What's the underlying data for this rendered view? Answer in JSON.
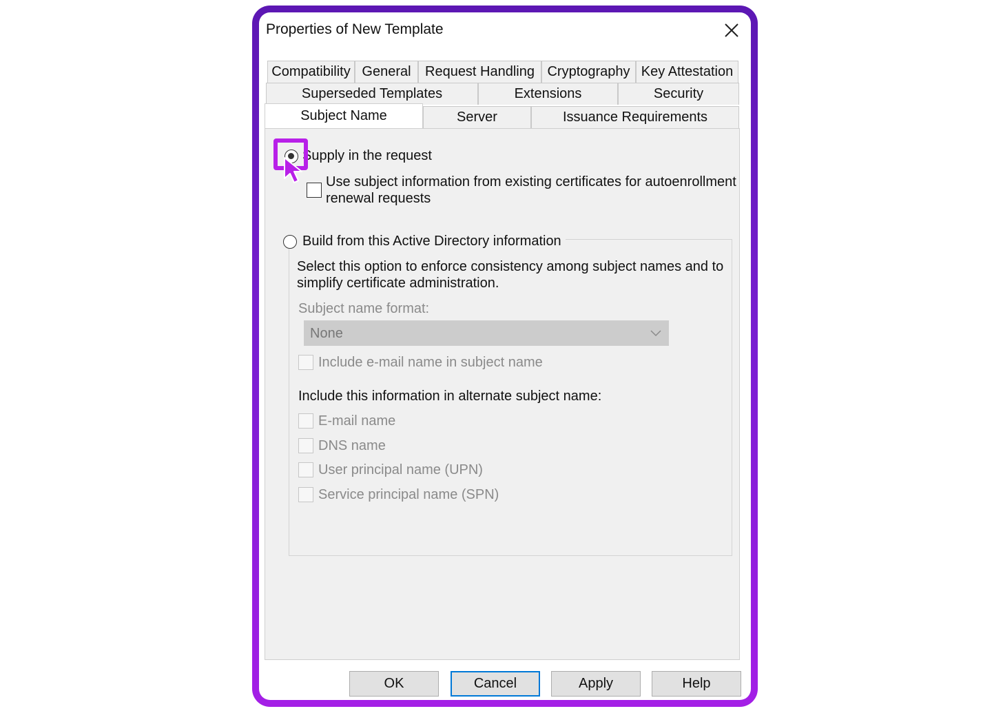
{
  "window": {
    "title": "Properties of New Template",
    "close_icon": "close-icon"
  },
  "tabs": {
    "row1": [
      "Compatibility",
      "General",
      "Request Handling",
      "Cryptography",
      "Key Attestation"
    ],
    "row2": [
      "Superseded Templates",
      "Extensions",
      "Security"
    ],
    "row3": [
      "Subject Name",
      "Server",
      "Issuance Requirements"
    ],
    "active": "Subject Name"
  },
  "subject": {
    "supply_label": "Supply in the request",
    "supply_selected": true,
    "autoenroll_line1": "Use subject information from existing certificates for autoenrollment",
    "autoenroll_line2": "renewal requests",
    "autoenroll_checked": false,
    "build_label": "Build from this Active Directory information",
    "build_selected": false,
    "build_desc_line1": "Select this option to enforce consistency among subject names and to",
    "build_desc_line2": "simplify certificate administration.",
    "format_label": "Subject name format:",
    "format_value": "None",
    "include_email_label": "Include e-mail name in subject name",
    "alt_header": "Include this information in alternate subject name:",
    "alt_items": [
      "E-mail name",
      "DNS name",
      "User principal name (UPN)",
      "Service principal name (SPN)"
    ]
  },
  "buttons": {
    "ok": "OK",
    "cancel": "Cancel",
    "apply": "Apply",
    "help": "Help"
  },
  "colors": {
    "frame_gradient_top": "#5c17b3",
    "frame_gradient_bottom": "#a41fe6",
    "highlight": "#b820e8",
    "default_button_border": "#0078d7"
  }
}
